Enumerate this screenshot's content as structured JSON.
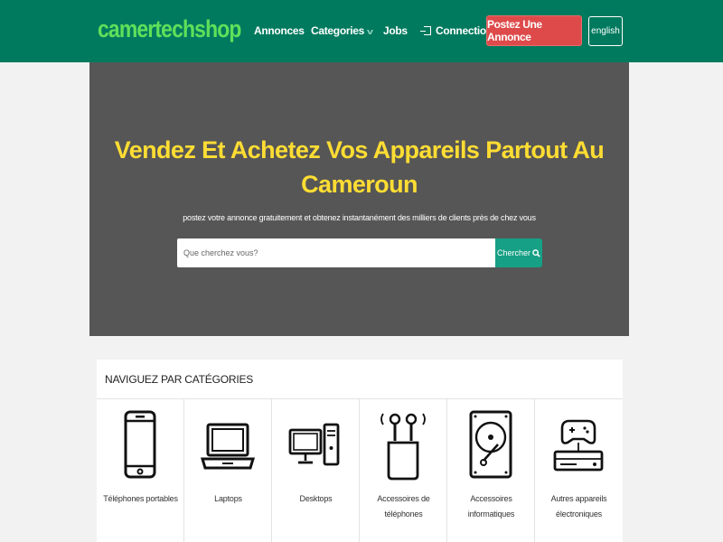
{
  "header": {
    "logo": "camertechshop",
    "nav": [
      {
        "label": "Annonces"
      },
      {
        "label": "Categories"
      },
      {
        "label": "Jobs"
      },
      {
        "label": "Connection"
      }
    ],
    "post_button": "Postez Une Annonce",
    "language_button": "english"
  },
  "hero": {
    "title": "Vendez Et Achetez Vos Appareils Partout Au Cameroun",
    "subtitle": "postez votre annonce gratuitement et obtenez instantanément des milliers de clients près de chez vous",
    "search_placeholder": "Que cherchez vous?",
    "search_button": "Chercher"
  },
  "categories": {
    "heading": "NAVIGUEZ PAR CATÉGORIES",
    "items": [
      {
        "label": "Téléphones portables",
        "icon": "smartphone-icon"
      },
      {
        "label": "Laptops",
        "icon": "laptop-icon"
      },
      {
        "label": "Desktops",
        "icon": "desktop-icon"
      },
      {
        "label": "Accessoires de téléphones",
        "icon": "earbuds-icon"
      },
      {
        "label": "Accessoires informatiques",
        "icon": "hard-drive-icon"
      },
      {
        "label": "Autres appareils électroniques",
        "icon": "game-console-icon"
      }
    ]
  },
  "colors": {
    "header_bg": "#007a5e",
    "logo": "#5fe05a",
    "hero_bg": "#565656",
    "hero_title": "#ffdd33",
    "post_button": "#de4a4a",
    "search_button": "#16a085"
  }
}
